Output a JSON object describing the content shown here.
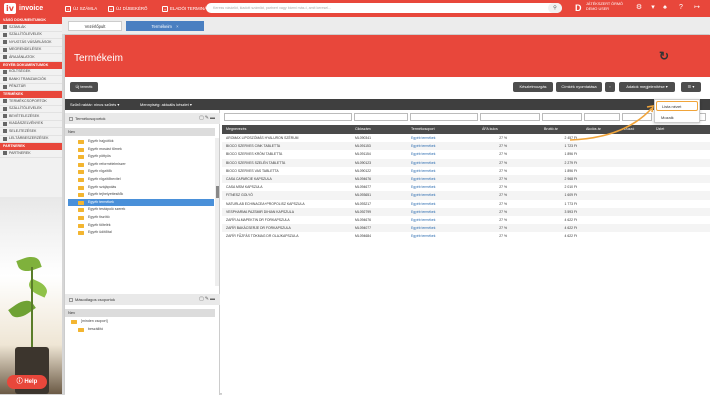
{
  "app": {
    "logo_text": "invoice",
    "logo_mark": "iv"
  },
  "topbar": {
    "new_invoice": "ÚJ SZÁMLA",
    "new_receipt": "ÚJ DÍJBEKÉRŐ",
    "new_terminal": "ELADÓI TERMINÁL",
    "search_placeholder": "Keress vásárlót, kiadott számlát, partnert vagy bármi más-t, amit keresel...",
    "avatar_letter": "D",
    "user_line1": "JÁTÉKSZERT ÓRMÓ",
    "user_line2": "DEMO USER"
  },
  "sidebar": {
    "sections": [
      {
        "head": "VÁSÓ DOKUMENTUMOK",
        "items": [
          "SZÁMLÁK",
          "SZÁLLÍTÓLEVELEK",
          "NYUGTÁS VÁSÁRLÁSOK",
          "MEGRENDELÉSEK",
          "ÁRAJÁNLATOK"
        ]
      },
      {
        "head": "EGYÉB DOKUMENTUMOK",
        "items": [
          "KÖLTSÉGEK",
          "BANKI TRANZAKCIÓK",
          "PÉNZTÁR"
        ]
      },
      {
        "head": "TERMÉKEK",
        "items": [
          "TERMÉKCSOPORTOK",
          "SZÁLLÍTÓLEVELEK",
          "BEVÉTELEZÉSEK",
          "KIADÁSZELVÉNYEK",
          "SELEJTEZÉSEK",
          "LELTÁRBESZERZÉSEK"
        ]
      },
      {
        "head": "PARTNEREK",
        "items": [
          "PARTNEREK"
        ]
      }
    ],
    "help_label": "Help"
  },
  "tabs": [
    "Vezérlőpult",
    "Termékeim"
  ],
  "page": {
    "title": "Termékeim",
    "new_product": "Új termék",
    "btn_stock": "Készletmozgás",
    "btn_labels": "Címkék nyomtatása",
    "btn_export": "Adatok megjelenítése",
    "filter1": "Szűrő raktár: nincs szűrés",
    "filter2": "Mennyiség: aktuális készlet"
  },
  "left_pane": {
    "groups_title": "Termékcsoportok",
    "name_header": "Nev",
    "tree": [
      "Egyéb hajpótlók",
      "Egyéb mosást tűrnek",
      "Egyéb pöttyös",
      "Egyéb reformélelmiszer",
      "Egyéb rögzítők",
      "Egyéb rögzítőbevitel",
      "Egyéb szájápolás",
      "Egyéb tejhelyettesítők",
      "Egyéb termékek",
      "Egyéb testápoló szerek",
      "Egyéb tisztító",
      "Egyéb töltelék",
      "Egyéb üdítőital"
    ],
    "selected_index": 8,
    "secondary_title": "Másodlagos csoportok",
    "secondary_header": "Nev",
    "secondary_tree": [
      "[minden csoport]",
      "beszállító"
    ]
  },
  "table": {
    "headers": [
      "Megnevezés",
      "Cikkszám",
      "Termékcsoport",
      "ÁFA kulcs",
      "Bruttó ár",
      "Akciós ár",
      "Duzzó",
      "Üzlet"
    ],
    "rows": [
      [
        "AROMAX LIPOSZÓMÁS HYALURON SZÉRUM",
        "ML090341",
        "Egyéb termékek",
        "27 %",
        "2 457 Ft"
      ],
      [
        "BIOCO SZERVES CINK TABLETTA",
        "ML091153",
        "Egyéb termékek",
        "27 %",
        "1 723 Ft"
      ],
      [
        "BIOCO SZERVES KRÓM TABLETTA",
        "ML091154",
        "Egyéb termékek",
        "27 %",
        "1 896 Ft"
      ],
      [
        "BIOCO SZERVES SZELÉN TABLETTA",
        "ML090123",
        "Egyéb termékek",
        "27 %",
        "2 279 Ft"
      ],
      [
        "BIOCO SZERVES VAS TABLETTA",
        "ML090122",
        "Egyéb termékek",
        "27 %",
        "1 896 Ft"
      ],
      [
        "CASA CAPARCIE KAPSZULA",
        "ML094676",
        "Egyéb termékek",
        "27 %",
        "2 968 Ft"
      ],
      [
        "CASA MSM KAPSZULA",
        "ML094677",
        "Egyéb termékek",
        "27 %",
        "2 010 Ft"
      ],
      [
        "FITNESZ GOLYÓ",
        "ML093651",
        "Egyéb termékek",
        "27 %",
        "1 609 Ft"
      ],
      [
        "NATURLAB ECHINACEA+PROPOLISZ KAPSZULA",
        "ML093217",
        "Egyéb termékek",
        "27 %",
        "1 773 Ft"
      ],
      [
        "VESPHARMA PAZSMIR DIHIAN KAPSZULA",
        "ML092799",
        "Egyéb termékek",
        "27 %",
        "3 593 Ft"
      ],
      [
        "ZAFÍR ALMAPEKTIN DR FORKAPSZULA",
        "ML094676",
        "Egyéb termékek",
        "27 %",
        "4 622 Ft"
      ],
      [
        "ZAFÍR BAKÁCSERJE DR FORKAPSZULA",
        "ML094077",
        "Egyéb termékek",
        "27 %",
        "4 622 Ft"
      ],
      [
        "ZAFÍR FŰZFÁS TÖKMAG DR OLAJKAPSZULA",
        "ML094684",
        "Egyéb termékek",
        "27 %",
        "4 622 Ft"
      ]
    ]
  },
  "dropdown": {
    "items": [
      "Lista nézet",
      "Mozaik"
    ]
  },
  "colors": {
    "brand": "#e8473b",
    "accent": "#4a90d9",
    "highlight": "#f0a43a"
  }
}
